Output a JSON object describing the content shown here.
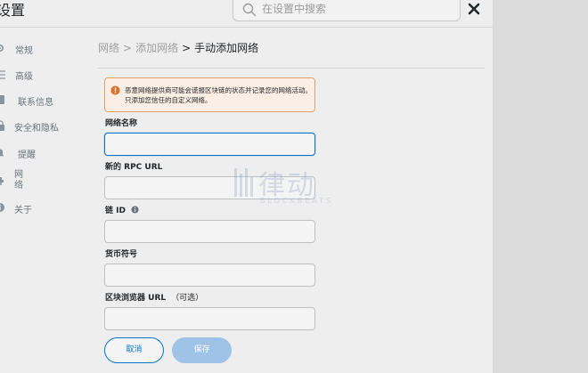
{
  "header": {
    "title": "设置",
    "search_placeholder": "在设置中搜索"
  },
  "sidebar": {
    "items": [
      {
        "label": "常规",
        "icon": "gear-icon"
      },
      {
        "label": "高级",
        "icon": "sliders-icon"
      },
      {
        "label": "联系信息",
        "icon": "address-book-icon"
      },
      {
        "label": "安全和隐私",
        "icon": "lock-icon"
      },
      {
        "label": "提醒",
        "icon": "bell-icon"
      },
      {
        "label": "网络",
        "icon": "plug-icon"
      },
      {
        "label": "关于",
        "icon": "info-icon"
      }
    ]
  },
  "breadcrumb": {
    "items": [
      "网络",
      "添加网络"
    ],
    "separator": ">",
    "current": "手动添加网络"
  },
  "warning": {
    "text": "恶意网络提供商可能会谎报区块链的状态并记录您的网络活动。只添加您信任的自定义网络。"
  },
  "form": {
    "network_name_label": "网络名称",
    "rpc_url_label": "新的 RPC URL",
    "chain_id_label": "链 ID",
    "currency_symbol_label": "货币符号",
    "explorer_url_label": "区块浏览器 URL",
    "explorer_url_optional": "（可选）"
  },
  "buttons": {
    "cancel": "取消",
    "save": "保存"
  },
  "watermark": {
    "cn": "律动",
    "en": "BLOCKBEATS"
  },
  "colors": {
    "accent": "#0376c9",
    "warning_border": "#e5a06a",
    "warning_bg": "#fbeee4",
    "save_disabled": "#9fc3e6"
  }
}
